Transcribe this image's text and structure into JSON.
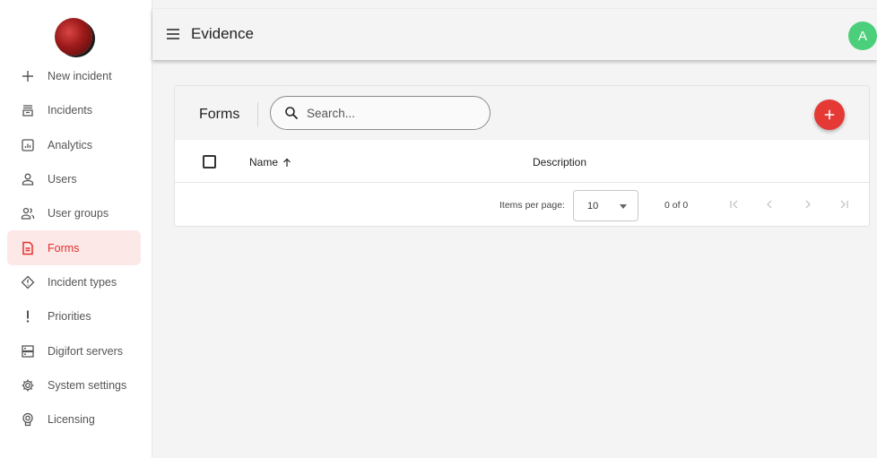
{
  "header": {
    "title": "Evidence",
    "avatar_initial": "A",
    "avatar_color": "#4ccf7a"
  },
  "sidebar": {
    "items": [
      {
        "label": "New incident",
        "icon": "plus-icon"
      },
      {
        "label": "Incidents",
        "icon": "inbox-icon"
      },
      {
        "label": "Analytics",
        "icon": "analytics-icon"
      },
      {
        "label": "Users",
        "icon": "user-icon"
      },
      {
        "label": "User groups",
        "icon": "user-group-icon"
      },
      {
        "label": "Forms",
        "icon": "form-icon",
        "active": true
      },
      {
        "label": "Incident types",
        "icon": "diamond-alert-icon"
      },
      {
        "label": "Priorities",
        "icon": "exclamation-icon"
      },
      {
        "label": "Digifort servers",
        "icon": "server-icon"
      },
      {
        "label": "System settings",
        "icon": "gear-icon"
      },
      {
        "label": "Licensing",
        "icon": "license-icon"
      }
    ]
  },
  "main": {
    "card_title": "Forms",
    "search": {
      "placeholder": "Search...",
      "value": ""
    },
    "table": {
      "columns": [
        "Name",
        "Description"
      ],
      "rows": []
    },
    "paginator": {
      "items_per_page_label": "Items per page:",
      "items_per_page": "10",
      "range": "0 of 0"
    }
  },
  "colors": {
    "accent": "#e53935",
    "active_bg": "#fde8e8",
    "active_text": "#e0302c"
  }
}
